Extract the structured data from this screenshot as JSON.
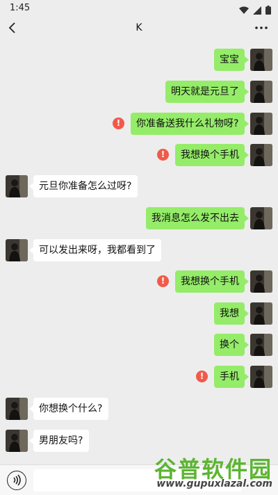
{
  "status_bar": {
    "time": "1:45"
  },
  "header": {
    "title": "K"
  },
  "messages": [
    {
      "from": "me",
      "text": "宝宝",
      "failed": false
    },
    {
      "from": "me",
      "text": "明天就是元旦了",
      "failed": false
    },
    {
      "from": "me",
      "text": "你准备送我什么礼物呀?",
      "failed": true
    },
    {
      "from": "me",
      "text": "我想换个手机",
      "failed": true
    },
    {
      "from": "other",
      "text": "元旦你准备怎么过呀?",
      "failed": false
    },
    {
      "from": "me",
      "text": "我消息怎么发不出去",
      "failed": false
    },
    {
      "from": "other",
      "text": "可以发出来呀，我都看到了",
      "failed": false
    },
    {
      "from": "me",
      "text": "我想换个手机",
      "failed": true
    },
    {
      "from": "me",
      "text": "我想",
      "failed": false
    },
    {
      "from": "me",
      "text": "换个",
      "failed": false
    },
    {
      "from": "me",
      "text": "手机",
      "failed": true
    },
    {
      "from": "other",
      "text": "你想换个什么?",
      "failed": false
    },
    {
      "from": "other",
      "text": "男朋友吗?",
      "failed": false
    }
  ],
  "error_glyph": "!",
  "colors": {
    "me_bubble": "#95ec69",
    "other_bubble": "#ffffff",
    "error": "#f15a4a",
    "background": "#ededed"
  },
  "watermark": {
    "title": "谷普软件园",
    "url": "www.gupuxlazal.com"
  }
}
